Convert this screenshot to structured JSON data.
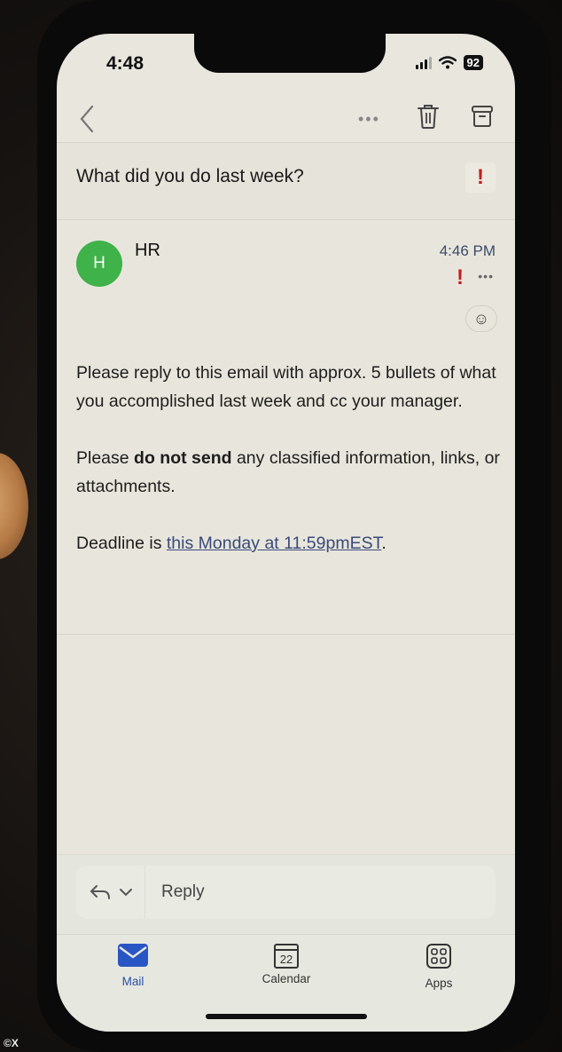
{
  "status_bar": {
    "time": "4:48",
    "battery": "92"
  },
  "toolbar": {
    "back_icon": "chevron-left-icon",
    "more_icon": "ellipsis-icon",
    "more_label": "•••",
    "trash_icon": "trash-icon",
    "archive_icon": "archive-icon"
  },
  "email": {
    "subject": "What did you do last week?",
    "importance_flag": "!",
    "sender_initial": "H",
    "sender_name": "HR",
    "time": "4:46 PM",
    "msg_flag": "!",
    "msg_more": "•••",
    "reaction_icon": "☺",
    "body": {
      "p1": "Please reply to this email with approx. 5 bullets of what you accomplished last week and cc your manager.",
      "p2_pre": "Please ",
      "p2_bold": "do not send",
      "p2_post": " any classified information, links, or attachments.",
      "p3_pre": "Deadline is ",
      "p3_link": "this Monday at 11:59pmEST",
      "p3_post": "."
    }
  },
  "reply": {
    "label": "Reply"
  },
  "tabbar": {
    "tabs": [
      {
        "label": "Mail",
        "icon": "mail-icon",
        "active": true
      },
      {
        "label": "Calendar",
        "icon": "calendar-icon",
        "date": "22",
        "active": false
      },
      {
        "label": "Apps",
        "icon": "apps-icon",
        "active": false
      }
    ]
  },
  "colors": {
    "accent": "#2a4ea8",
    "avatar": "#3fb24a",
    "flag": "#c21d1d",
    "link": "#3a4a7a"
  },
  "watermark": "©X"
}
